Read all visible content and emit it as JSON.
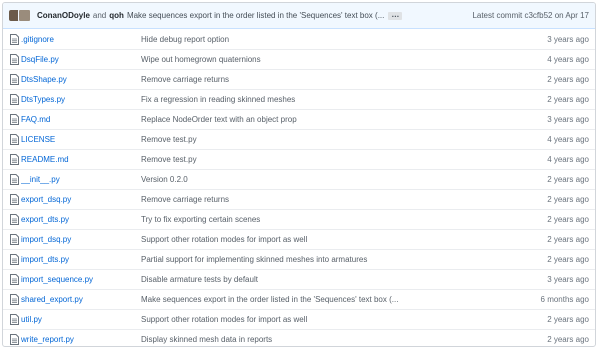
{
  "commit": {
    "author1": "ConanODoyle",
    "and_text": "and",
    "author2": "qoh",
    "message": "Make sequences export in the order listed in the 'Sequences' text box (...",
    "ellipsis": "…",
    "latest_label": "Latest commit",
    "sha": "c3cfb52",
    "on": "on",
    "date": "Apr 17"
  },
  "files": [
    {
      "name": ".gitignore",
      "message": "Hide debug report option",
      "age": "3 years ago",
      "icon": "file-icon"
    },
    {
      "name": "DsqFile.py",
      "message": "Wipe out homegrown quaternions",
      "age": "4 years ago",
      "icon": "file-icon"
    },
    {
      "name": "DtsShape.py",
      "message": "Remove carriage returns",
      "age": "2 years ago",
      "icon": "file-icon"
    },
    {
      "name": "DtsTypes.py",
      "message": "Fix a regression in reading skinned meshes",
      "age": "2 years ago",
      "icon": "file-icon"
    },
    {
      "name": "FAQ.md",
      "message": "Replace NodeOrder text with an object prop",
      "age": "3 years ago",
      "icon": "file-icon"
    },
    {
      "name": "LICENSE",
      "message": "Remove test.py",
      "age": "4 years ago",
      "icon": "file-icon"
    },
    {
      "name": "README.md",
      "message": "Remove test.py",
      "age": "4 years ago",
      "icon": "file-icon"
    },
    {
      "name": "__init__.py",
      "message": "Version 0.2.0",
      "age": "2 years ago",
      "icon": "file-icon"
    },
    {
      "name": "export_dsq.py",
      "message": "Remove carriage returns",
      "age": "2 years ago",
      "icon": "file-icon"
    },
    {
      "name": "export_dts.py",
      "message": "Try to fix exporting certain scenes",
      "age": "2 years ago",
      "icon": "file-icon"
    },
    {
      "name": "import_dsq.py",
      "message": "Support other rotation modes for import as well",
      "age": "2 years ago",
      "icon": "file-icon"
    },
    {
      "name": "import_dts.py",
      "message": "Partial support for implementing skinned meshes into armatures",
      "age": "2 years ago",
      "icon": "file-icon"
    },
    {
      "name": "import_sequence.py",
      "message": "Disable armature tests by default",
      "age": "3 years ago",
      "icon": "file-icon"
    },
    {
      "name": "shared_export.py",
      "message": "Make sequences export in the order listed in the 'Sequences' text box (...",
      "age": "6 months ago",
      "icon": "file-icon"
    },
    {
      "name": "util.py",
      "message": "Support other rotation modes for import as well",
      "age": "2 years ago",
      "icon": "file-icon"
    },
    {
      "name": "write_report.py",
      "message": "Display skinned mesh data in reports",
      "age": "2 years ago",
      "icon": "file-icon"
    }
  ]
}
